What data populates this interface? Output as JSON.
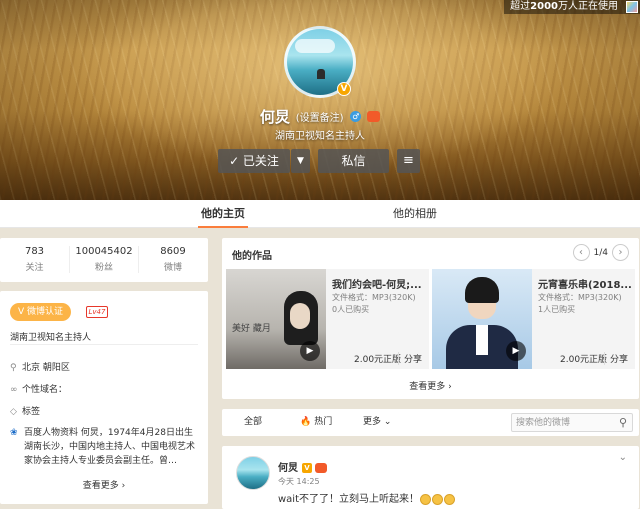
{
  "header": {
    "online_prefix": "超过",
    "online_count": "2000",
    "online_suffix": "万人正在使用",
    "name": "何炅",
    "remark": "(设置备注)",
    "gender_symbol": "♂",
    "verified_symbol": "V",
    "intro": "湖南卫视知名主持人",
    "follow_label": "✓ 已关注",
    "follow_arrow": "▼",
    "message_label": "私信",
    "more_label": "≡"
  },
  "tabs": [
    {
      "label": "他的主页",
      "active": true
    },
    {
      "label": "他的相册",
      "active": false
    }
  ],
  "stats": [
    {
      "value": "783",
      "label": "关注"
    },
    {
      "value": "100045402",
      "label": "粉丝"
    },
    {
      "value": "8609",
      "label": "微博"
    }
  ],
  "info": {
    "verified_badge": "V 微博认证",
    "level": "Lv47",
    "description": "湖南卫视知名主持人",
    "location": "北京 朝阳区",
    "domain": "个性域名：",
    "tags": "标签",
    "baike": "百度人物资料 何炅，1974年4月28日出生湖南长沙，中国内地主持人、中国电视艺术家协会主持人专业委员会副主任。曾…",
    "more": "查看更多 ›"
  },
  "works": {
    "title": "他的作品",
    "page": "1/4",
    "prev": "‹",
    "next": "›",
    "items": [
      {
        "title": "我们约会吧-何炅;...",
        "format": "文件格式：MP3(320K)",
        "buyers": "0人已购买",
        "price": "2.00元正版",
        "share": "分享",
        "cover_caption": "美好 藏月"
      },
      {
        "title": "元宵喜乐串(2018...",
        "format": "文件格式：MP3(320K)",
        "buyers": "1人已购买",
        "price": "2.00元正版",
        "share": "分享"
      }
    ],
    "more": "查看更多 ›"
  },
  "filter": {
    "all": "全部",
    "hot": "热门",
    "more": "更多 ⌄",
    "search_placeholder": "搜索他的微博"
  },
  "feed": {
    "name": "何炅",
    "time": "今天 14:25",
    "text": "wait不了了！立刻马上听起来！",
    "menu": "⌄"
  },
  "colors": {
    "accent": "#fa7d3c",
    "verified": "#f7a600",
    "level": "#e7372a"
  }
}
